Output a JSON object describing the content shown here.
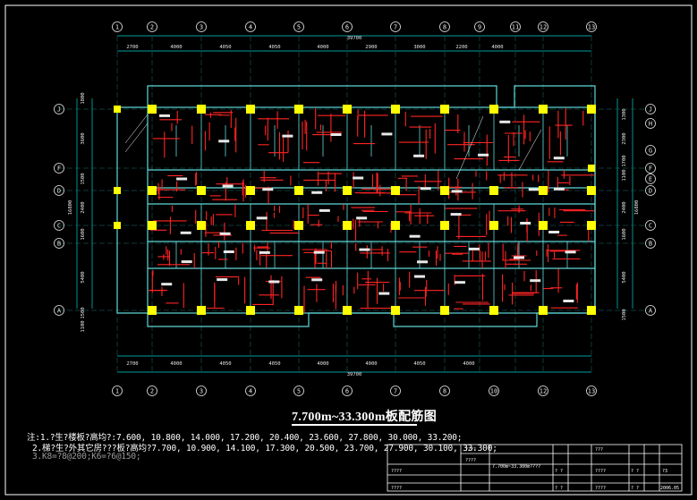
{
  "title": "7.700m~33.300m板配筋图",
  "notes": [
    "注:1.?生?楼板?高均?:7.600, 10.800, 14.000, 17.200, 20.400, 23.600, 27.800, 30.000, 33.200;",
    "2.梯?生?外其它房???板?高均?7.700, 10.900, 14.100, 17.300, 20.500, 23.700, 27.900, 30.100, 33.300;",
    "3.K8=?8@200;K6=?6@150;"
  ],
  "axes_top": [
    "1",
    "2",
    "3",
    "4",
    "5",
    "6",
    "7",
    "8",
    "9",
    "11",
    "12",
    "13"
  ],
  "axes_bottom": [
    "1",
    "2",
    "3",
    "4",
    "5",
    "6",
    "7",
    "8",
    "10",
    "12",
    "13"
  ],
  "axes_left": [
    "J",
    "F",
    "D",
    "C",
    "B",
    "A"
  ],
  "axes_right": [
    "J",
    "H",
    "G",
    "F",
    "E",
    "D",
    "C",
    "B",
    "A"
  ],
  "dims_top": [
    "2700",
    "4000",
    "4050",
    "4050",
    "4000",
    "2900",
    "3000",
    "2200",
    "4000"
  ],
  "dims_top_total": "39700",
  "dims_bottom": [
    "2700",
    "4000",
    "4050",
    "4050",
    "4000",
    "4000",
    "4050",
    "4000"
  ],
  "dims_bottom_total": "39700",
  "dims_left": [
    "1800",
    "3600",
    "1500",
    "2400",
    "1600",
    "5400",
    "1500",
    "1100"
  ],
  "dims_left_total": "16800",
  "dims_right": [
    "1300",
    "2300",
    "1700",
    "1100",
    "2400",
    "1600",
    "5400",
    "1500"
  ],
  "dims_right_total": "16800",
  "title_block": {
    "row1": [
      "????",
      "???",
      "????"
    ],
    "row2": [
      "????",
      "7.700m~33.300m????",
      "?  ?",
      "????",
      "?  ?",
      "?3"
    ],
    "row3": [
      "????",
      "?  ?",
      "????",
      "?  ?",
      "2006.05"
    ]
  },
  "colors": {
    "background": "#000000",
    "grid": "#00c8c8",
    "rebar": "#ff2020",
    "column": "#ffff00",
    "text": "#ffffff",
    "wall": "#5fd7d7"
  }
}
